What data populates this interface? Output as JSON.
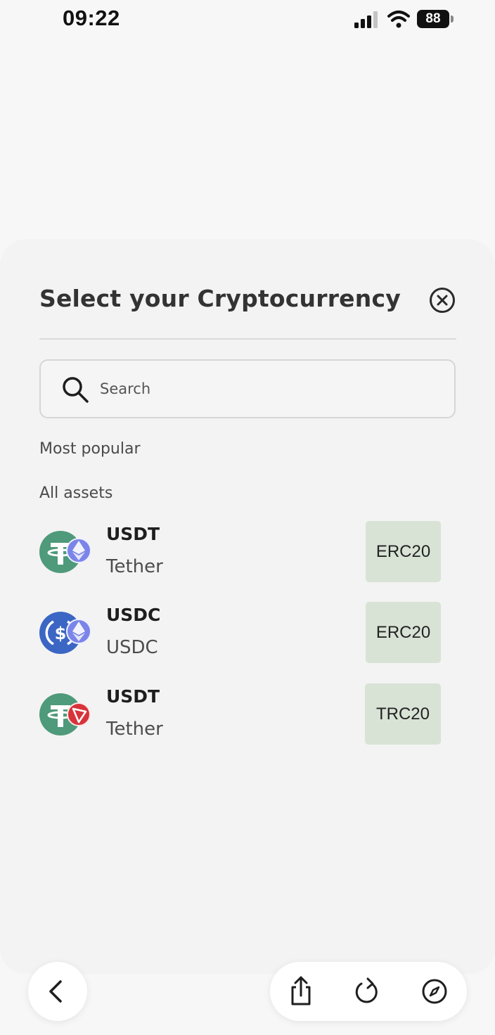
{
  "status_bar": {
    "time": "09:22",
    "battery": "88",
    "icons": [
      "signal-icon",
      "wifi-icon",
      "battery-icon"
    ]
  },
  "sheet": {
    "title": "Select your Cryptocurrency",
    "close_icon": "close-circle-icon",
    "search": {
      "placeholder": "Search",
      "value": "",
      "icon": "search-icon"
    },
    "sections": {
      "popular": "Most popular",
      "all": "All assets"
    },
    "assets": [
      {
        "symbol": "USDT",
        "name": "Tether",
        "network": "ERC20",
        "icon": "tether-ethereum-icon"
      },
      {
        "symbol": "USDC",
        "name": "USDC",
        "network": "ERC20",
        "icon": "usdc-ethereum-icon"
      },
      {
        "symbol": "USDT",
        "name": "Tether",
        "network": "TRC20",
        "icon": "tether-tron-icon"
      }
    ]
  },
  "toolbar": {
    "icons": [
      "back-chevron-icon",
      "share-icon",
      "reload-icon",
      "compass-icon"
    ]
  },
  "colors": {
    "tether": "#4e9a7a",
    "usdc": "#3b66c4",
    "ethereum_badge": "#7b84e8",
    "tron_badge": "#d8323a",
    "network_badge_bg": "#d8e3d6"
  }
}
